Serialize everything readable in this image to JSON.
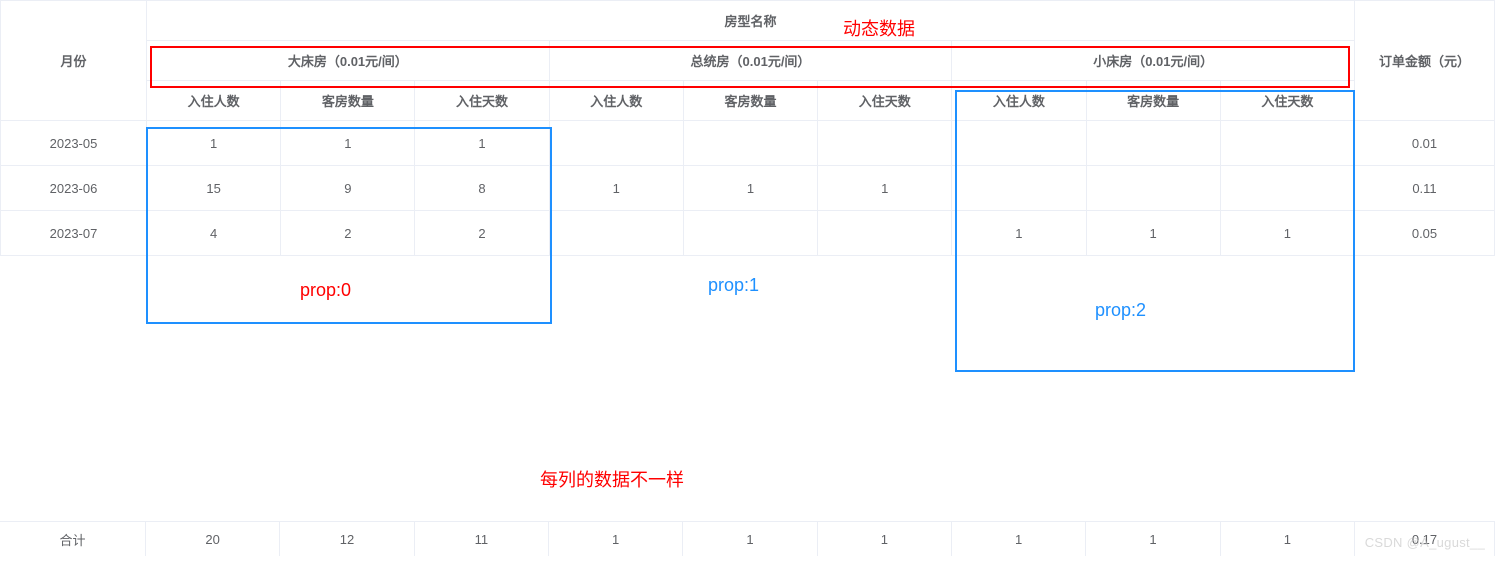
{
  "table": {
    "header": {
      "month": "月份",
      "room_group": "房型名称",
      "order_amount": "订单金额（元）",
      "rooms": [
        {
          "name": "大床房（0.01元/间）"
        },
        {
          "name": "总统房（0.01元/间）"
        },
        {
          "name": "小床房（0.01元/间）"
        }
      ],
      "sub": {
        "guests": "入住人数",
        "room_count": "客房数量",
        "days": "入住天数"
      }
    },
    "rows": [
      {
        "month": "2023-05",
        "r0_guests": "1",
        "r0_rooms": "1",
        "r0_days": "1",
        "r1_guests": "",
        "r1_rooms": "",
        "r1_days": "",
        "r2_guests": "",
        "r2_rooms": "",
        "r2_days": "",
        "amount": "0.01"
      },
      {
        "month": "2023-06",
        "r0_guests": "15",
        "r0_rooms": "9",
        "r0_days": "8",
        "r1_guests": "1",
        "r1_rooms": "1",
        "r1_days": "1",
        "r2_guests": "",
        "r2_rooms": "",
        "r2_days": "",
        "amount": "0.11"
      },
      {
        "month": "2023-07",
        "r0_guests": "4",
        "r0_rooms": "2",
        "r0_days": "2",
        "r1_guests": "",
        "r1_rooms": "",
        "r1_days": "",
        "r2_guests": "1",
        "r2_rooms": "1",
        "r2_days": "1",
        "amount": "0.05"
      }
    ],
    "footer": {
      "label": "合计",
      "r0_guests": "20",
      "r0_rooms": "12",
      "r0_days": "11",
      "r1_guests": "1",
      "r1_rooms": "1",
      "r1_days": "1",
      "r2_guests": "1",
      "r2_rooms": "1",
      "r2_days": "1",
      "amount": "0.17"
    }
  },
  "annotations": {
    "dynamic_data": "动态数据",
    "prop0": "prop:0",
    "prop1": "prop:1",
    "prop2": "prop:2",
    "col_note": "每列的数据不一样"
  },
  "watermark": "CSDN @A_ugust__",
  "colors": {
    "red": "#FF0000",
    "blue": "#1E90FF"
  }
}
